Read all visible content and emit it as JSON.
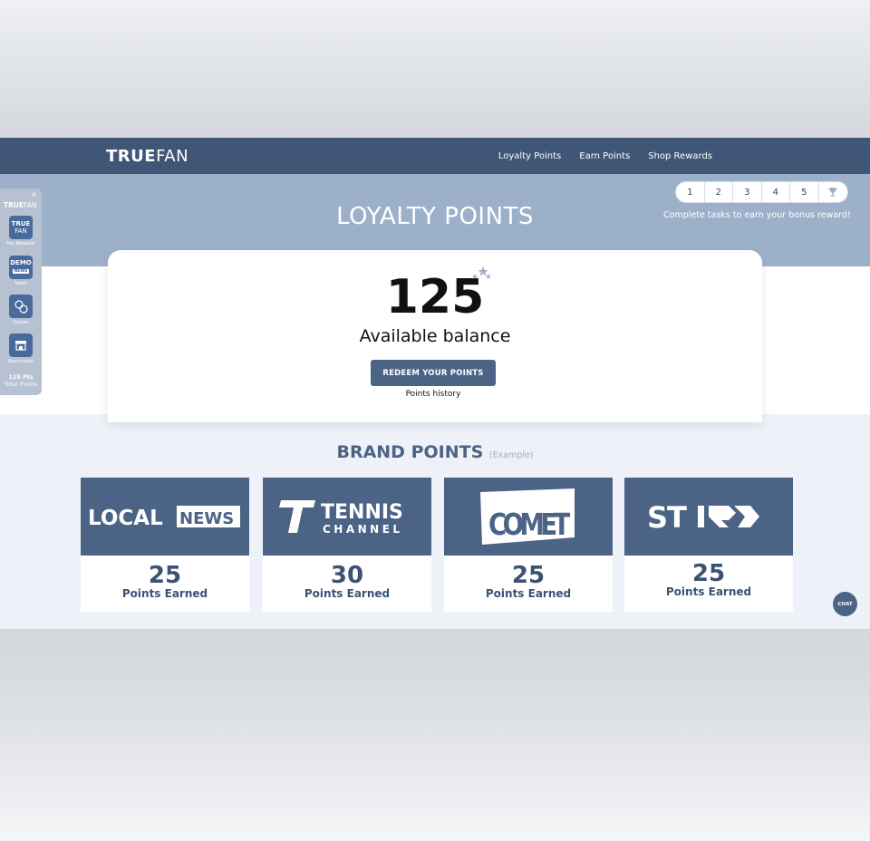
{
  "header": {
    "logo_bold": "TRUE",
    "logo_light": "FAN",
    "nav": [
      "Loyalty Points",
      "Earn Points",
      "Shop Rewards"
    ]
  },
  "hero": {
    "title": "LOYALTY POINTS",
    "steps": [
      "1",
      "2",
      "3",
      "4",
      "5"
    ],
    "steps_trophy_icon": "trophy-icon",
    "steps_caption": "Complete tasks to earn your bonus reward!"
  },
  "balance": {
    "value": "125",
    "label": "Available balance",
    "redeem_label": "REDEEM YOUR POINTS",
    "history_label": "Points history"
  },
  "brands": {
    "heading": "BRAND POINTS",
    "heading_note": "(Example)",
    "items": [
      {
        "logo_text": "LOCAL NEWS",
        "points": "25",
        "label": "Points Earned"
      },
      {
        "logo_text": "TENNIS CHANNEL",
        "points": "30",
        "label": "Points Earned"
      },
      {
        "logo_text": "COMET",
        "points": "25",
        "label": "Points Earned"
      },
      {
        "logo_text": "STIRR",
        "points": "25",
        "label": "Points Earned"
      }
    ]
  },
  "sidebar": {
    "close": "×",
    "brand_bold": "TRUE",
    "brand_light": "FAN",
    "items": [
      {
        "icon_text_1": "TRUE",
        "icon_text_2": "FAN",
        "label": "Fan Rewards"
      },
      {
        "icon_text_1": "DEMO",
        "icon_text_2": "NEWS",
        "label": "News"
      },
      {
        "icon": "games-icon",
        "label": "Games"
      },
      {
        "icon": "store-icon",
        "label": "Businesses"
      }
    ],
    "total_points": "125 Pts",
    "total_label": "Total Points"
  },
  "chat": {
    "label": "CHAT"
  },
  "colors": {
    "navbar": "#3f5677",
    "hero": "#9db0ca",
    "accent": "#4b6384"
  }
}
